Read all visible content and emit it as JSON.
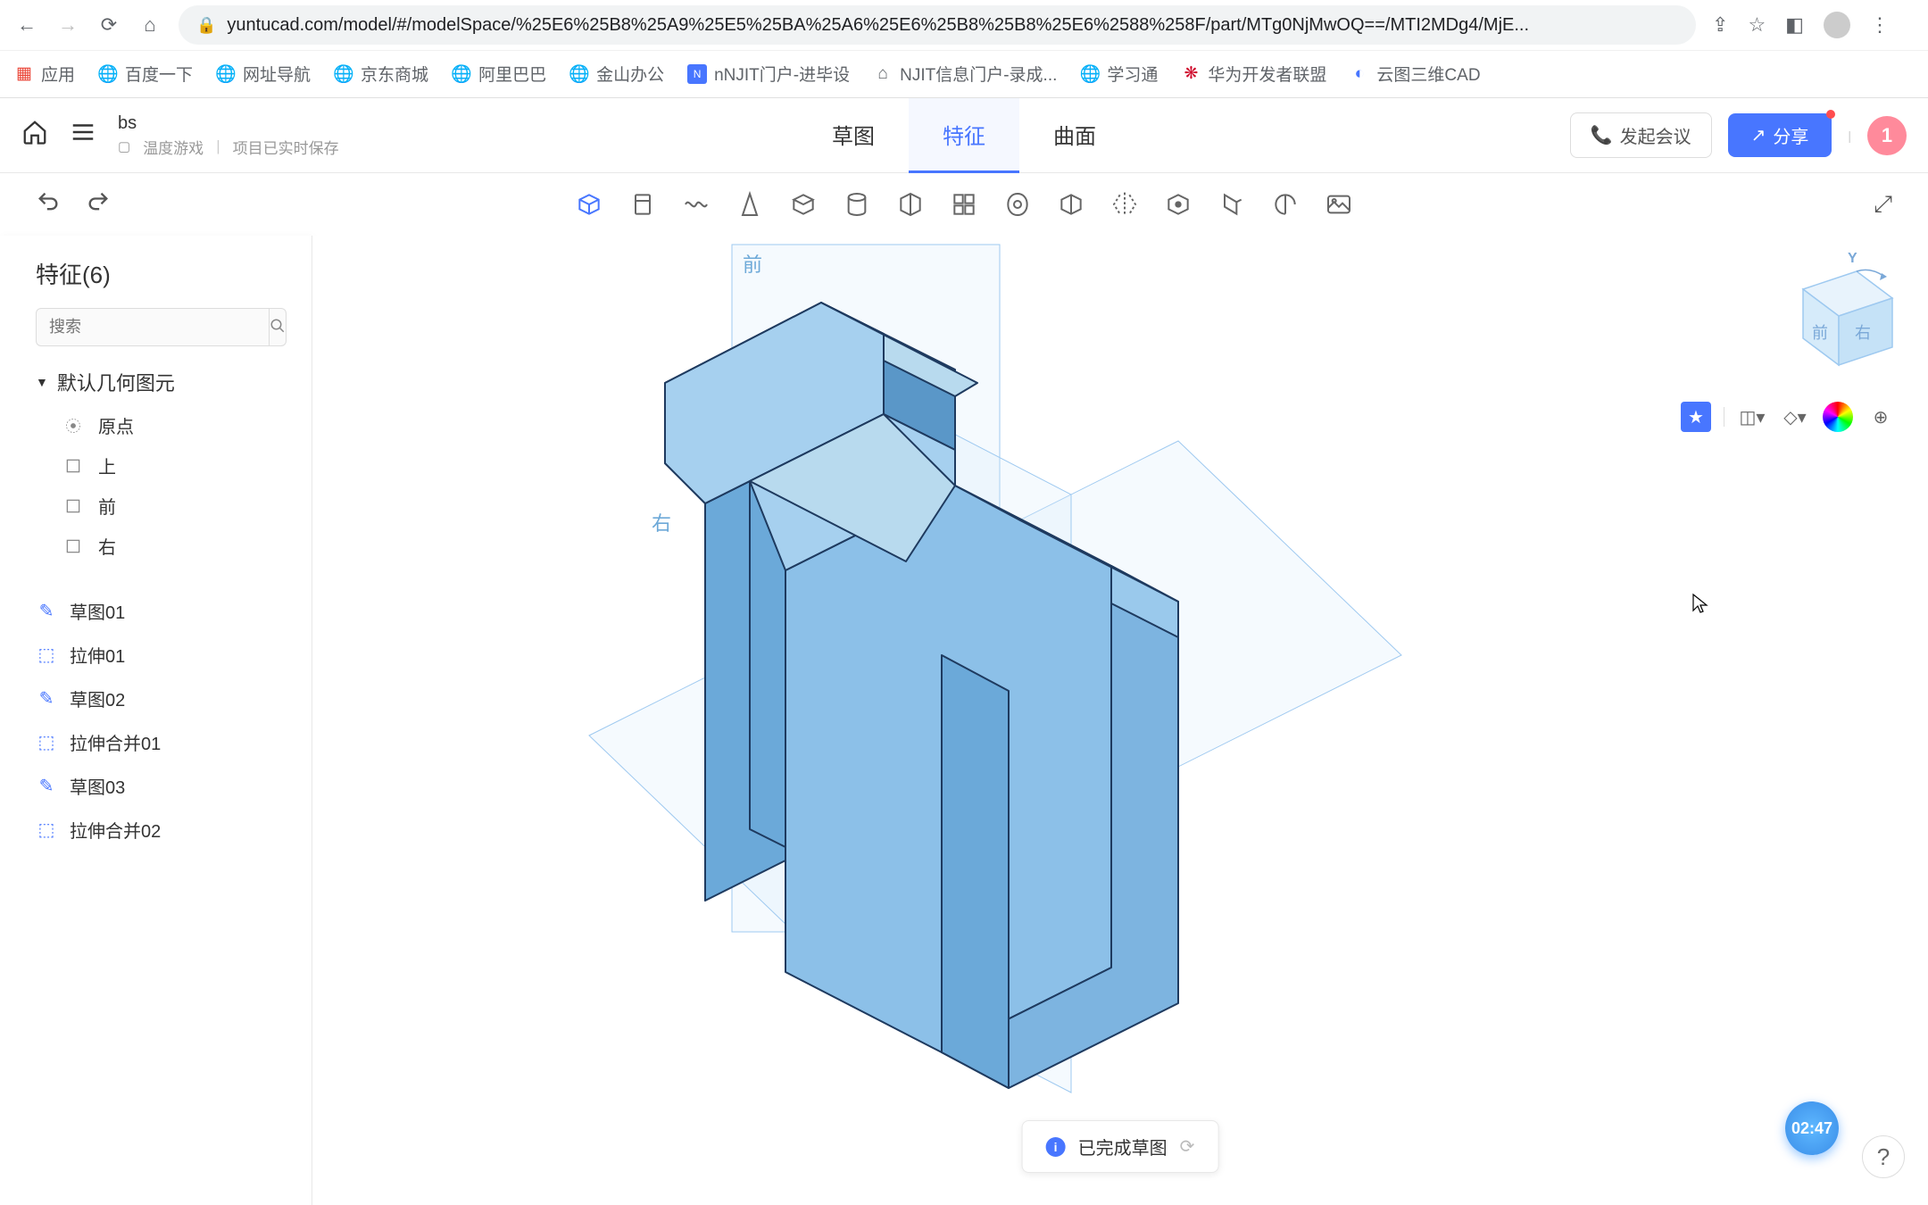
{
  "browser": {
    "url": "yuntucad.com/model/#/modelSpace/%25E6%25B8%25A9%25E5%25BA%25A6%25E6%25B8%25B8%25E6%2588%258F/part/MTg0NjMwOQ==/MTI2MDg4/MjE...",
    "bookmarks": [
      {
        "label": "应用",
        "icon": "apps"
      },
      {
        "label": "百度一下",
        "icon": "globe"
      },
      {
        "label": "网址导航",
        "icon": "globe"
      },
      {
        "label": "京东商城",
        "icon": "globe"
      },
      {
        "label": "阿里巴巴",
        "icon": "globe"
      },
      {
        "label": "金山办公",
        "icon": "globe"
      },
      {
        "label": "nNJIT门户-进毕设",
        "icon": "square-blue"
      },
      {
        "label": "NJIT信息门户-录成...",
        "icon": "home"
      },
      {
        "label": "学习通",
        "icon": "globe"
      },
      {
        "label": "华为开发者联盟",
        "icon": "huawei"
      },
      {
        "label": "云图三维CAD",
        "icon": "yuntu"
      }
    ]
  },
  "header": {
    "doc_title": "bs",
    "folder": "温度游戏",
    "save_status": "项目已实时保存",
    "tabs": [
      "草图",
      "特征",
      "曲面"
    ],
    "active_tab": 1,
    "meeting_btn": "发起会议",
    "share_btn": "分享",
    "user_initial": "1"
  },
  "sidebar": {
    "title": "特征(6)",
    "search_placeholder": "搜索",
    "default_group": "默认几何图元",
    "geometry_items": [
      {
        "label": "原点",
        "icon": "origin"
      },
      {
        "label": "上",
        "icon": "plane"
      },
      {
        "label": "前",
        "icon": "plane"
      },
      {
        "label": "右",
        "icon": "plane"
      }
    ],
    "features": [
      {
        "label": "草图01",
        "icon": "sketch"
      },
      {
        "label": "拉伸01",
        "icon": "extrude"
      },
      {
        "label": "草图02",
        "icon": "sketch"
      },
      {
        "label": "拉伸合并01",
        "icon": "extrude"
      },
      {
        "label": "草图03",
        "icon": "sketch"
      },
      {
        "label": "拉伸合并02",
        "icon": "extrude"
      }
    ]
  },
  "viewport": {
    "plane_labels": {
      "front": "前",
      "right": "右"
    },
    "cube_labels": {
      "y": "Y",
      "front": "前",
      "right": "右"
    }
  },
  "status": {
    "message": "已完成草图"
  },
  "timer": "02:47"
}
